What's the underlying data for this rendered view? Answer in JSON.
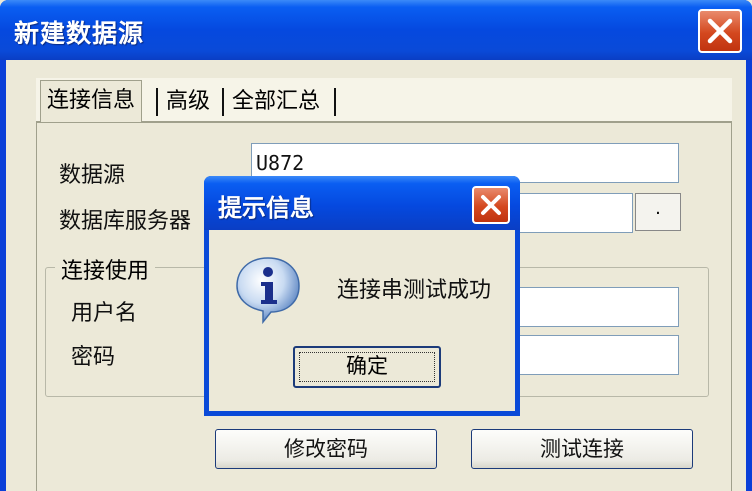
{
  "window": {
    "title": "新建数据源"
  },
  "tabs": [
    {
      "label": "连接信息",
      "active": true
    },
    {
      "label": "高级",
      "active": false
    },
    {
      "label": "全部汇总",
      "active": false
    }
  ],
  "form": {
    "datasource_label": "数据源",
    "datasource_value": "U872",
    "db_server_label": "数据库服务器",
    "db_server_value": "",
    "browse_button_label": ".",
    "connection_group_label": "连接使用",
    "username_label": "用户名",
    "username_value": "",
    "password_label": "密码",
    "password_value": ""
  },
  "buttons": {
    "change_password": "修改密码",
    "test_connection": "测试连接"
  },
  "dialog": {
    "title": "提示信息",
    "message": "连接串测试成功",
    "ok_label": "确定",
    "icon": "info-icon"
  },
  "colors": {
    "title_bar": "#0549df",
    "close_button": "#d4481f",
    "window_bg": "#ece9d8"
  }
}
